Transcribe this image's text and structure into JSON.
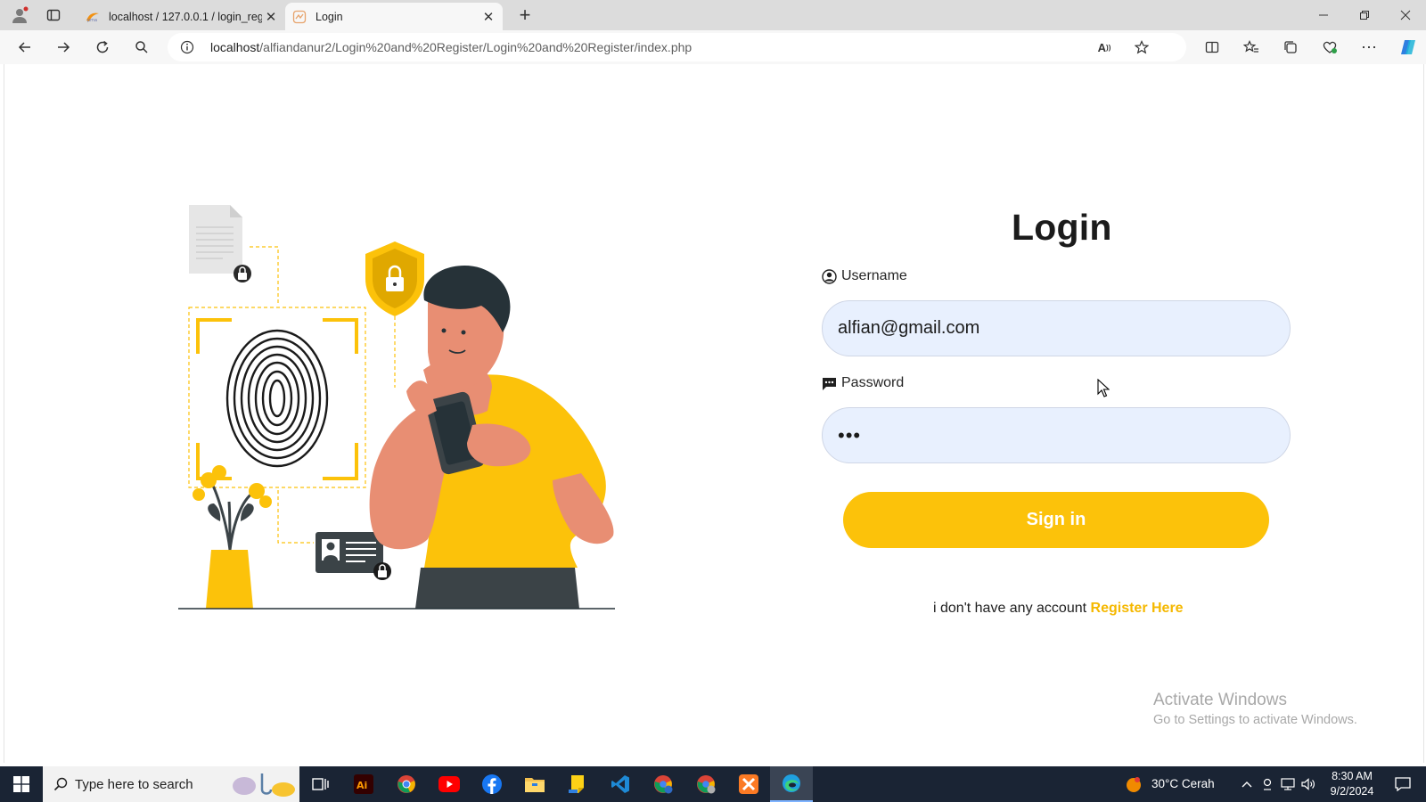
{
  "browser": {
    "tabs": [
      {
        "title": "localhost / 127.0.0.1 / login_regist",
        "active": false
      },
      {
        "title": "Login",
        "active": true
      }
    ],
    "url_host": "localhost",
    "url_path": "/alfiandanur2/Login%20and%20Register/Login%20and%20Register/index.php"
  },
  "login": {
    "title": "Login",
    "username_label": "Username",
    "username_value": "alfian@gmail.com",
    "password_label": "Password",
    "password_masked": "•••",
    "signin_label": "Sign in",
    "register_prompt": "i don't have any account",
    "register_link": "Register Here"
  },
  "watermark": {
    "line1": "Activate Windows",
    "line2": "Go to Settings to activate Windows."
  },
  "taskbar": {
    "search_placeholder": "Type here to search",
    "weather": "30°C  Cerah",
    "time": "8:30 AM",
    "date": "9/2/2024"
  },
  "colors": {
    "accent": "#fcc20a",
    "link": "#f5b800",
    "input_bg": "#e8f0fe",
    "taskbar": "#1a2434"
  }
}
